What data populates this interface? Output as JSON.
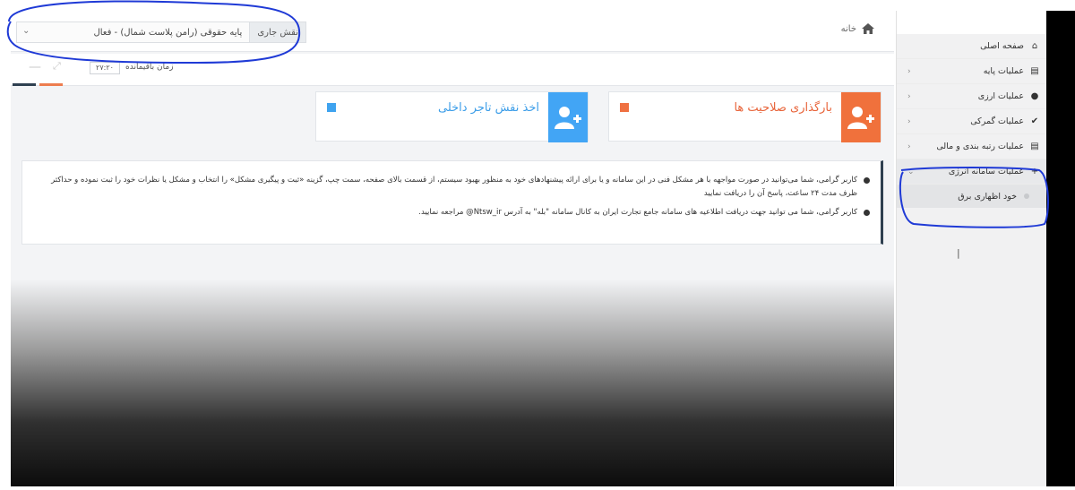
{
  "header": {
    "role_label": "نقش جاری",
    "role_value": "پایه حقوقی (رامن پلاست شمال) - فعال",
    "breadcrumb_home": "خانه"
  },
  "timer": {
    "label": "زمان باقیمانده",
    "value": "۲۷:۲۰"
  },
  "cards": {
    "permissions": "بارگذاری صلاحیت ها",
    "trader": "اخذ نقش تاجر داخلی"
  },
  "notices": {
    "first": "کاربر گرامی، شما می‌توانید در صورت مواجهه با هر مشکل فنی در این سامانه و یا برای ارائه پیشنهادهای خود به منظور بهبود سیستم، از قسمت بالای صفحه، سمت چپ، گزینه «ثبت و پیگیری مشکل» را انتخاب و مشکل یا نظرات خود را ثبت نموده و حداکثر ظرف مدت ۲۴ ساعت، پاسخ آن را دریافت نمایید",
    "second": "کاربر گرامی، شما می توانید جهت دریافت اطلاعیه های سامانه جامع تجارت ایران به کانال سامانه \"بله\" به آدرس Ntsw_ir@ مراجعه نمایید."
  },
  "sidebar": {
    "items": [
      {
        "label": "صفحه اصلی",
        "icon": "home-icon"
      },
      {
        "label": "عملیات پایه",
        "icon": "chart-icon"
      },
      {
        "label": "عملیات ارزی",
        "icon": "user-plus-icon"
      },
      {
        "label": "عملیات گمرکی",
        "icon": "check-icon"
      },
      {
        "label": "عملیات رتبه بندی و مالی",
        "icon": "chart-icon"
      },
      {
        "label": "عملیات سامانه انرژی",
        "icon": "plus-icon"
      }
    ],
    "sub_item": "خود اظهاری برق"
  },
  "colors": {
    "accent_orange": "#f0713c",
    "accent_blue": "#42a5f5",
    "dark_navy": "#2f4050",
    "annotation_blue": "#1f3ad6"
  }
}
